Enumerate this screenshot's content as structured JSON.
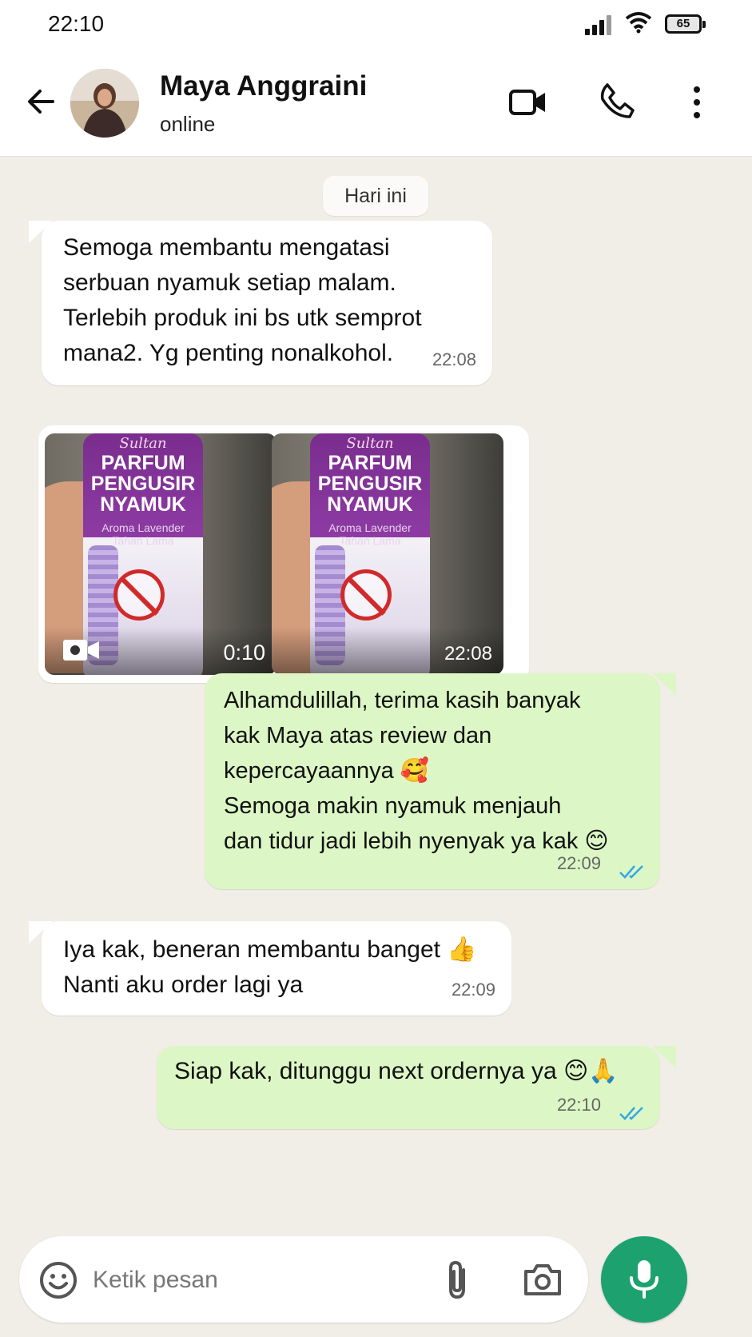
{
  "status_bar": {
    "time": "22:10",
    "battery": "65"
  },
  "header": {
    "name": "Maya Anggraini",
    "status": "online"
  },
  "chat": {
    "date_chip": "Hari ini",
    "messages": [
      {
        "text": "Semoga membantu mengatasi\nserbuan nyamuk setiap malam.\nTerlebih produk ini bs utk semprot\nmana2. Yg penting nonalkohol.",
        "time": "22:08"
      },
      {
        "media": [
          {
            "brand": "Sultan",
            "title": "PARFUM\nPENGUSIR\nNYAMUK",
            "subtitle": "Aroma Lavender\nTahan Lama",
            "duration": "0:10"
          },
          {
            "brand": "Sultan",
            "title": "PARFUM\nPENGUSIR\nNYAMUK",
            "subtitle": "Aroma Lavender\nTahan Lama",
            "time": "22:08"
          }
        ]
      },
      {
        "text": "Alhamdulillah, terima kasih banyak\nkak Maya atas review dan\nkepercayaannya 🥰\nSemoga makin nyamuk menjauh\ndan tidur jadi lebih nyenyak ya kak 😊",
        "time": "22:09"
      },
      {
        "text": "Iya kak, beneran membantu banget 👍\nNanti aku order lagi ya",
        "time": "22:09"
      },
      {
        "text": "Siap kak, ditunggu next ordernya ya 😊🙏",
        "time": "22:10"
      }
    ]
  },
  "composer": {
    "placeholder": "Ketik pesan"
  },
  "colors": {
    "incoming": "#ffffff",
    "outgoing": "#dcf7c5",
    "accent": "#1da26f",
    "read_ticks": "#34a7e4"
  },
  "icons": [
    "back-arrow-icon",
    "video-call-icon",
    "phone-icon",
    "more-vert-icon",
    "emoji-icon",
    "attach-icon",
    "camera-icon",
    "mic-icon",
    "double-check-icon",
    "video-camera-icon"
  ]
}
